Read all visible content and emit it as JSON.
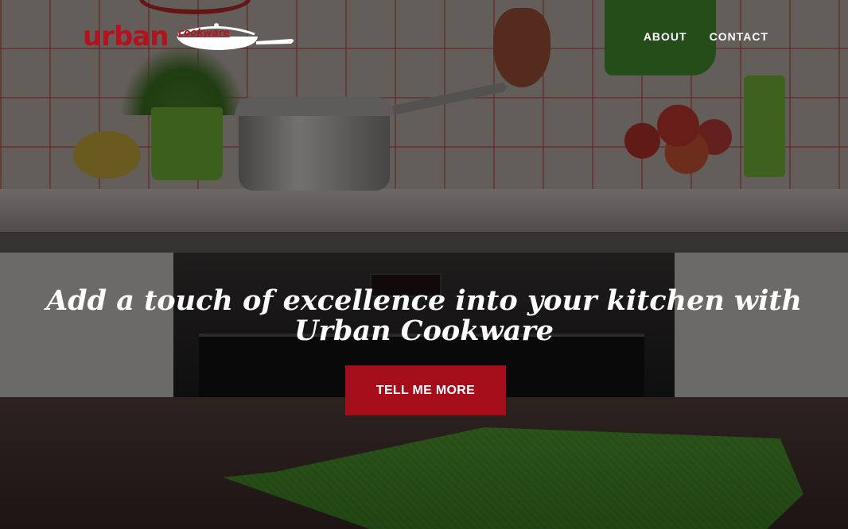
{
  "brand": {
    "name_primary": "urban",
    "name_secondary": "cookware",
    "color": "#b2131f"
  },
  "nav": {
    "items": [
      {
        "label": "ABOUT"
      },
      {
        "label": "CONTACT"
      }
    ]
  },
  "hero": {
    "headline_line1": "Add a touch of excellence into your kitchen with",
    "headline_line2": "Urban Cookware",
    "cta_label": "TELL ME MORE",
    "cta_color": "#a50d1a",
    "background_image": "kitchen-counter-photo"
  }
}
